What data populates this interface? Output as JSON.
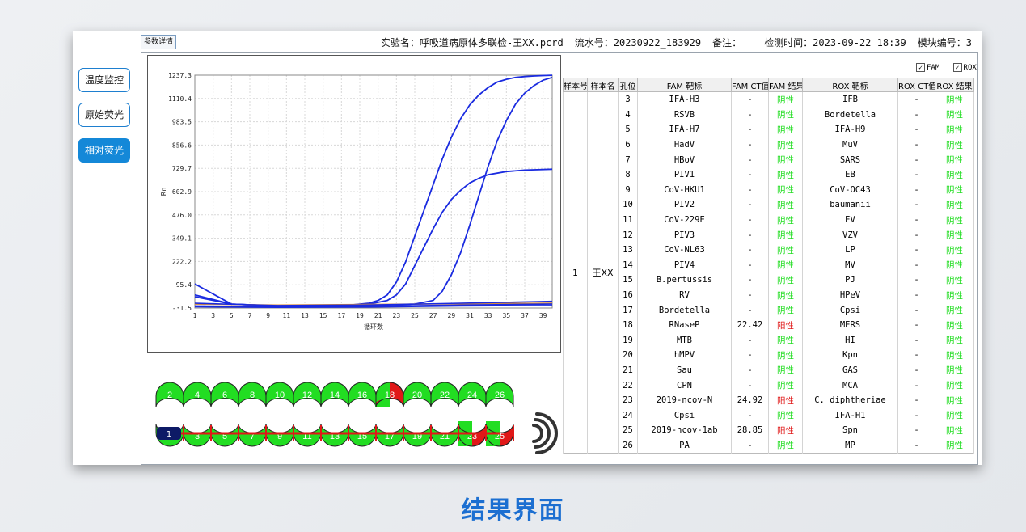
{
  "topbar": {
    "param_button": "参数详情",
    "experiment_label": "实验名：",
    "experiment_name": "呼吸道病原体多联检-王XX.pcrd",
    "serial_label": "流水号：",
    "serial": "20230922_183929",
    "remark_label": "备注：",
    "time_label": "检测时间：",
    "time": "2023-09-22 18:39",
    "module_label": "模块编号：",
    "module": "3"
  },
  "sidebar": {
    "items": [
      {
        "label": "温度监控",
        "active": false
      },
      {
        "label": "原始荧光",
        "active": false
      },
      {
        "label": "相对荧光",
        "active": true
      }
    ]
  },
  "checkboxes": {
    "fam": "FAM",
    "rox": "ROX"
  },
  "chart_data": {
    "type": "line",
    "ylabel": "Rn",
    "xlabel": "循环数",
    "x_ticks": [
      "1",
      "3",
      "5",
      "7",
      "9",
      "11",
      "13",
      "15",
      "17",
      "19",
      "21",
      "23",
      "25",
      "27",
      "29",
      "31",
      "33",
      "35",
      "37",
      "39"
    ],
    "y_ticks": [
      "1237.3",
      "1110.4",
      "983.5",
      "856.6",
      "729.7",
      "602.9",
      "476.0",
      "349.1",
      "222.2",
      "95.4",
      "-31.5"
    ],
    "xlim": [
      1,
      40
    ],
    "ylim": [
      -31.5,
      1237.3
    ],
    "series": [
      {
        "color": "#1a2be0",
        "x": [
          1,
          5,
          10,
          15,
          18,
          20,
          21,
          22,
          23,
          24,
          25,
          26,
          27,
          28,
          29,
          30,
          31,
          32,
          33,
          34,
          35,
          36,
          37,
          38,
          39,
          40
        ],
        "y": [
          40,
          -10,
          -20,
          -20,
          -15,
          -5,
          10,
          40,
          110,
          220,
          360,
          500,
          640,
          780,
          900,
          1000,
          1075,
          1130,
          1170,
          1200,
          1215,
          1225,
          1230,
          1233,
          1235,
          1237
        ]
      },
      {
        "color": "#1a2be0",
        "x": [
          1,
          5,
          10,
          15,
          20,
          22,
          23,
          24,
          25,
          26,
          27,
          28,
          29,
          30,
          31,
          32,
          33,
          35,
          37,
          40
        ],
        "y": [
          30,
          -10,
          -20,
          -20,
          -10,
          10,
          40,
          100,
          200,
          300,
          400,
          490,
          560,
          610,
          650,
          675,
          695,
          712,
          720,
          725
        ]
      },
      {
        "color": "#1a2be0",
        "x": [
          1,
          5,
          10,
          15,
          20,
          25,
          27,
          28,
          29,
          30,
          31,
          32,
          33,
          34,
          35,
          36,
          37,
          38,
          39,
          40
        ],
        "y": [
          100,
          -10,
          -20,
          -20,
          -18,
          -10,
          10,
          60,
          150,
          270,
          420,
          580,
          740,
          880,
          990,
          1080,
          1140,
          1180,
          1210,
          1225
        ]
      },
      {
        "color": "#d88a3a",
        "x": [
          1,
          10,
          20,
          30,
          40
        ],
        "y": [
          -10,
          -15,
          -12,
          -8,
          -5
        ]
      },
      {
        "color": "#1a2be0",
        "x": [
          1,
          10,
          20,
          30,
          40
        ],
        "y": [
          -20,
          -25,
          -22,
          -15,
          -10
        ]
      },
      {
        "color": "#1a2be0",
        "x": [
          1,
          10,
          20,
          30,
          40
        ],
        "y": [
          -5,
          -18,
          -15,
          -5,
          5
        ]
      },
      {
        "color": "#1a2be0",
        "x": [
          1,
          10,
          20,
          30,
          40
        ],
        "y": [
          -25,
          -28,
          -26,
          -20,
          -18
        ]
      }
    ]
  },
  "wheel": {
    "top": [
      {
        "n": "2",
        "state": "neg"
      },
      {
        "n": "4",
        "state": "neg"
      },
      {
        "n": "6",
        "state": "neg"
      },
      {
        "n": "8",
        "state": "neg"
      },
      {
        "n": "10",
        "state": "neg"
      },
      {
        "n": "12",
        "state": "neg"
      },
      {
        "n": "14",
        "state": "neg"
      },
      {
        "n": "16",
        "state": "neg"
      },
      {
        "n": "18",
        "state": "pos"
      },
      {
        "n": "20",
        "state": "neg"
      },
      {
        "n": "22",
        "state": "neg"
      },
      {
        "n": "24",
        "state": "neg"
      },
      {
        "n": "26",
        "state": "neg"
      }
    ],
    "bottom": [
      {
        "n": "1",
        "state": "neg"
      },
      {
        "n": "3",
        "state": "neg"
      },
      {
        "n": "5",
        "state": "neg"
      },
      {
        "n": "7",
        "state": "neg"
      },
      {
        "n": "9",
        "state": "neg"
      },
      {
        "n": "11",
        "state": "neg"
      },
      {
        "n": "13",
        "state": "neg"
      },
      {
        "n": "15",
        "state": "neg"
      },
      {
        "n": "17",
        "state": "neg"
      },
      {
        "n": "19",
        "state": "neg"
      },
      {
        "n": "21",
        "state": "neg"
      },
      {
        "n": "23",
        "state": "pos"
      },
      {
        "n": "25",
        "state": "pos"
      }
    ],
    "handle_label": "1"
  },
  "table": {
    "headers": [
      "样本号",
      "样本名",
      "孔位",
      "FAM 靶标",
      "FAM CT值",
      "FAM 结果",
      "ROX 靶标",
      "ROX CT值",
      "ROX 结果"
    ],
    "sample_no": "1",
    "sample_name": "王XX",
    "rows": [
      {
        "well": "3",
        "fam": "IFA-H3",
        "fam_ct": "-",
        "fam_res": "阴性",
        "rox": "IFB",
        "rox_ct": "-",
        "rox_res": "阴性"
      },
      {
        "well": "4",
        "fam": "RSVB",
        "fam_ct": "-",
        "fam_res": "阴性",
        "rox": "Bordetella",
        "rox_ct": "-",
        "rox_res": "阴性"
      },
      {
        "well": "5",
        "fam": "IFA-H7",
        "fam_ct": "-",
        "fam_res": "阴性",
        "rox": "IFA-H9",
        "rox_ct": "-",
        "rox_res": "阴性"
      },
      {
        "well": "6",
        "fam": "HadV",
        "fam_ct": "-",
        "fam_res": "阴性",
        "rox": "MuV",
        "rox_ct": "-",
        "rox_res": "阴性"
      },
      {
        "well": "7",
        "fam": "HBoV",
        "fam_ct": "-",
        "fam_res": "阴性",
        "rox": "SARS",
        "rox_ct": "-",
        "rox_res": "阴性"
      },
      {
        "well": "8",
        "fam": "PIV1",
        "fam_ct": "-",
        "fam_res": "阴性",
        "rox": "EB",
        "rox_ct": "-",
        "rox_res": "阴性"
      },
      {
        "well": "9",
        "fam": "CoV-HKU1",
        "fam_ct": "-",
        "fam_res": "阴性",
        "rox": "CoV-OC43",
        "rox_ct": "-",
        "rox_res": "阴性"
      },
      {
        "well": "10",
        "fam": "PIV2",
        "fam_ct": "-",
        "fam_res": "阴性",
        "rox": "baumanii",
        "rox_ct": "-",
        "rox_res": "阴性"
      },
      {
        "well": "11",
        "fam": "CoV-229E",
        "fam_ct": "-",
        "fam_res": "阴性",
        "rox": "EV",
        "rox_ct": "-",
        "rox_res": "阴性"
      },
      {
        "well": "12",
        "fam": "PIV3",
        "fam_ct": "-",
        "fam_res": "阴性",
        "rox": "VZV",
        "rox_ct": "-",
        "rox_res": "阴性"
      },
      {
        "well": "13",
        "fam": "CoV-NL63",
        "fam_ct": "-",
        "fam_res": "阴性",
        "rox": "LP",
        "rox_ct": "-",
        "rox_res": "阴性"
      },
      {
        "well": "14",
        "fam": "PIV4",
        "fam_ct": "-",
        "fam_res": "阴性",
        "rox": "MV",
        "rox_ct": "-",
        "rox_res": "阴性"
      },
      {
        "well": "15",
        "fam": "B.pertussis",
        "fam_ct": "-",
        "fam_res": "阴性",
        "rox": "PJ",
        "rox_ct": "-",
        "rox_res": "阴性"
      },
      {
        "well": "16",
        "fam": "RV",
        "fam_ct": "-",
        "fam_res": "阴性",
        "rox": "HPeV",
        "rox_ct": "-",
        "rox_res": "阴性"
      },
      {
        "well": "17",
        "fam": "Bordetella",
        "fam_ct": "-",
        "fam_res": "阴性",
        "rox": "Cpsi",
        "rox_ct": "-",
        "rox_res": "阴性"
      },
      {
        "well": "18",
        "fam": "RNaseP",
        "fam_ct": "22.42",
        "fam_res": "阳性",
        "rox": "MERS",
        "rox_ct": "-",
        "rox_res": "阴性"
      },
      {
        "well": "19",
        "fam": "MTB",
        "fam_ct": "-",
        "fam_res": "阴性",
        "rox": "HI",
        "rox_ct": "-",
        "rox_res": "阴性"
      },
      {
        "well": "20",
        "fam": "hMPV",
        "fam_ct": "-",
        "fam_res": "阴性",
        "rox": "Kpn",
        "rox_ct": "-",
        "rox_res": "阴性"
      },
      {
        "well": "21",
        "fam": "Sau",
        "fam_ct": "-",
        "fam_res": "阴性",
        "rox": "GAS",
        "rox_ct": "-",
        "rox_res": "阴性"
      },
      {
        "well": "22",
        "fam": "CPN",
        "fam_ct": "-",
        "fam_res": "阴性",
        "rox": "MCA",
        "rox_ct": "-",
        "rox_res": "阴性"
      },
      {
        "well": "23",
        "fam": "2019-ncov-N",
        "fam_ct": "24.92",
        "fam_res": "阳性",
        "rox": "C. diphtheriae",
        "rox_ct": "-",
        "rox_res": "阴性"
      },
      {
        "well": "24",
        "fam": "Cpsi",
        "fam_ct": "-",
        "fam_res": "阴性",
        "rox": "IFA-H1",
        "rox_ct": "-",
        "rox_res": "阴性"
      },
      {
        "well": "25",
        "fam": "2019-ncov-1ab",
        "fam_ct": "28.85",
        "fam_res": "阳性",
        "rox": "Spn",
        "rox_ct": "-",
        "rox_res": "阴性"
      },
      {
        "well": "26",
        "fam": "PA",
        "fam_ct": "-",
        "fam_res": "阴性",
        "rox": "MP",
        "rox_ct": "-",
        "rox_res": "阴性"
      }
    ]
  },
  "colors": {
    "accent": "#1488d8",
    "negative": "#22dd22",
    "positive": "#e01818",
    "well_green": "#22dd22",
    "curve": "#1a2be0"
  },
  "caption": "结果界面"
}
